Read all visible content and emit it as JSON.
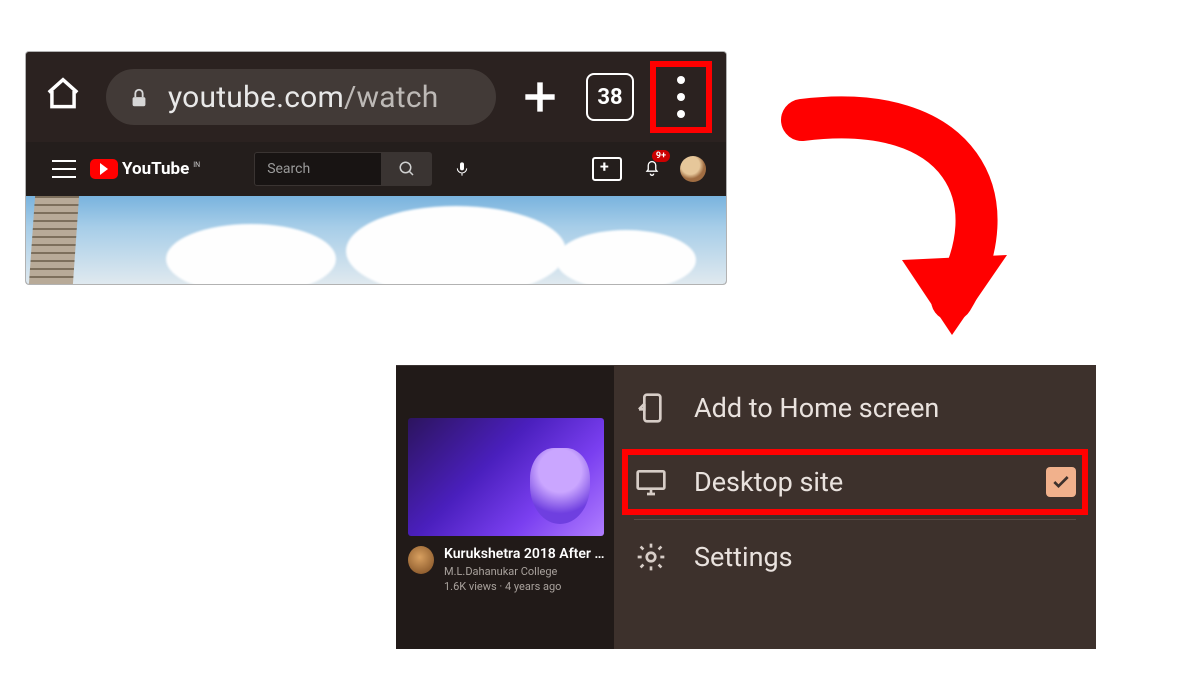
{
  "browser": {
    "url_host": "youtube.com",
    "url_path": "/watch",
    "tab_count": "38"
  },
  "youtube": {
    "brand": "YouTube",
    "region": "IN",
    "search_placeholder": "Search",
    "notification_count": "9+"
  },
  "menu": {
    "add_home": "Add to Home screen",
    "desktop_site": "Desktop site",
    "desktop_checked": true,
    "settings": "Settings"
  },
  "suggested": {
    "title": "Kurukshetra 2018 After M…",
    "channel": "M.L.Dahanukar College",
    "stats": "1.6K views · 4 years ago"
  },
  "highlight_color": "#ff0000"
}
